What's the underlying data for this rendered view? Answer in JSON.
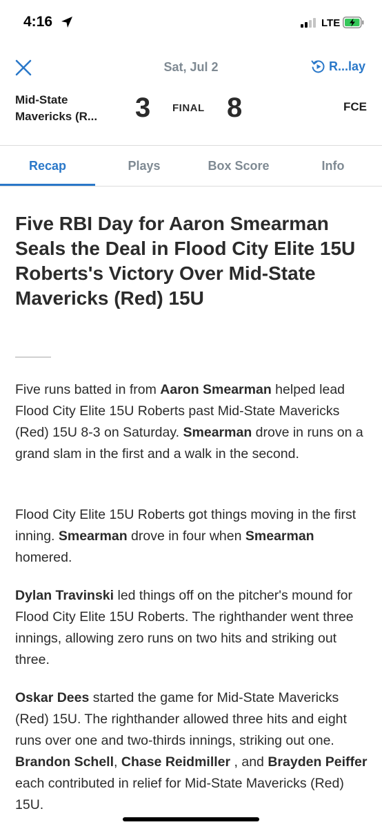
{
  "status_bar": {
    "time": "4:16",
    "network": "LTE"
  },
  "header": {
    "date": "Sat, Jul 2",
    "replay_label": "R...lay",
    "home_team_lines": [
      "Mid-State",
      "Mavericks (R..."
    ],
    "home_score": "3",
    "status": "FINAL",
    "away_score": "8",
    "away_team": "FCE"
  },
  "tabs": [
    {
      "label": "Recap",
      "active": true
    },
    {
      "label": "Plays",
      "active": false
    },
    {
      "label": "Box Score",
      "active": false
    },
    {
      "label": "Info",
      "active": false
    }
  ],
  "article": {
    "headline": "Five RBI Day for Aaron Smearman Seals the Deal in Flood City Elite 15U Roberts's Victory Over Mid-State Mavericks (Red) 15U",
    "paragraphs": [
      [
        {
          "t": "Five runs batted in from ",
          "b": false
        },
        {
          "t": "Aaron Smearman",
          "b": true
        },
        {
          "t": " helped lead Flood City Elite 15U Roberts past Mid-State Mavericks (Red) 15U 8-3 on Saturday.  ",
          "b": false
        },
        {
          "t": "Smearman",
          "b": true
        },
        {
          "t": " drove in runs on a grand slam in the first and a walk in the second.",
          "b": false
        }
      ],
      [
        {
          "t": "Flood City Elite 15U Roberts got things moving in the first inning.  ",
          "b": false
        },
        {
          "t": "Smearman",
          "b": true
        },
        {
          "t": " drove in four when ",
          "b": false
        },
        {
          "t": "Smearman",
          "b": true
        },
        {
          "t": " homered.",
          "b": false
        }
      ],
      [
        {
          "t": "Dylan Travinski",
          "b": true
        },
        {
          "t": " led things off on the pitcher's mound for Flood City Elite 15U Roberts. The righthander went three innings, allowing zero runs on two hits and striking out three.",
          "b": false
        }
      ],
      [
        {
          "t": "Oskar Dees",
          "b": true
        },
        {
          "t": " started the game for Mid-State Mavericks (Red) 15U. The righthander allowed three hits and eight runs over one and two-thirds innings, striking out one.  ",
          "b": false
        },
        {
          "t": "Brandon Schell",
          "b": true
        },
        {
          "t": ", ",
          "b": false
        },
        {
          "t": "Chase Reidmiller",
          "b": true
        },
        {
          "t": " , and ",
          "b": false
        },
        {
          "t": "Brayden Peiffer",
          "b": true
        },
        {
          "t": " each contributed in relief for Mid-State Mavericks (Red) 15U.",
          "b": false
        }
      ]
    ]
  },
  "colors": {
    "accent": "#2a78c9",
    "muted": "#7f8a93",
    "text": "#2b2b2b",
    "battery": "#34c759"
  }
}
